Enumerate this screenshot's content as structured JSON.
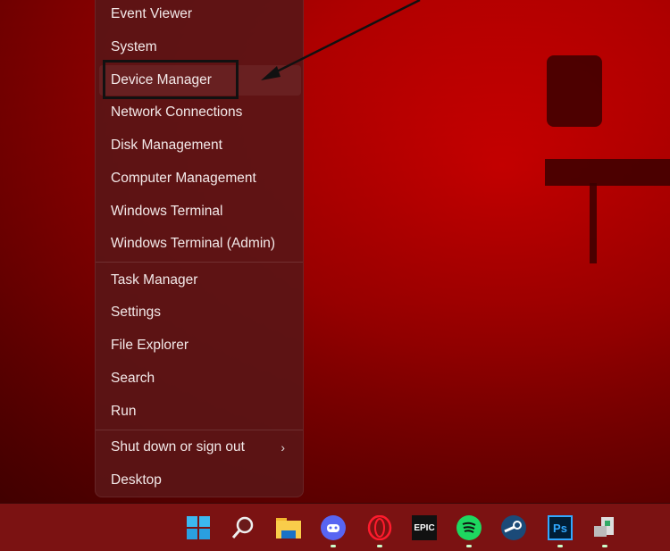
{
  "menu": {
    "items": [
      "Event Viewer",
      "System",
      "Device Manager",
      "Network Connections",
      "Disk Management",
      "Computer Management",
      "Windows Terminal",
      "Windows Terminal (Admin)",
      "Task Manager",
      "Settings",
      "File Explorer",
      "Search",
      "Run",
      "Shut down or sign out",
      "Desktop"
    ],
    "highlighted": "Device Manager"
  },
  "taskbar": {
    "icons": [
      "windows-start",
      "search",
      "file-explorer",
      "discord",
      "opera",
      "epic-games",
      "spotify",
      "steam",
      "photoshop",
      "device-manager"
    ],
    "epic_label": "EPIC",
    "ps_label": "Ps"
  },
  "colors": {
    "accent": "#d40000",
    "taskbar": "#7b1212",
    "menu": "#5a1416"
  }
}
